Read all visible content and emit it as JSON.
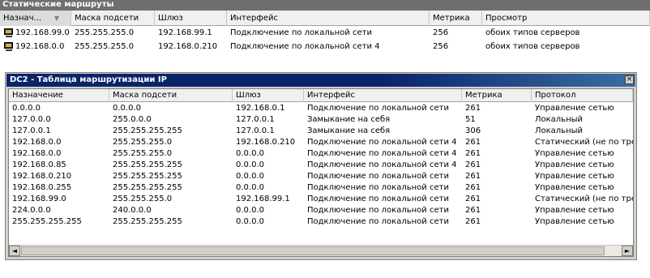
{
  "top": {
    "title": "Статические маршруты",
    "columns": [
      "Назнач...",
      "Маска подсети",
      "Шлюз",
      "Интерфейс",
      "Метрика",
      "Просмотр"
    ],
    "rows": [
      {
        "dest": "192.168.99.0",
        "mask": "255.255.255.0",
        "gateway": "192.168.99.1",
        "iface": "Подключение по локальной сети",
        "metric": "256",
        "view": "обоих типов серверов"
      },
      {
        "dest": "192.168.0.0",
        "mask": "255.255.255.0",
        "gateway": "192.168.0.210",
        "iface": "Подключение по локальной сети 4",
        "metric": "256",
        "view": "обоих типов серверов"
      }
    ]
  },
  "window": {
    "title": "DC2 - Таблица маршрутизации IP",
    "close_label": "×",
    "columns": [
      "Назначение",
      "Маска подсети",
      "Шлюз",
      "Интерфейс",
      "Метрика",
      "Протокол"
    ],
    "rows": [
      {
        "dest": "0.0.0.0",
        "mask": "0.0.0.0",
        "gateway": "192.168.0.1",
        "iface": "Подключение по локальной сети",
        "metric": "261",
        "protocol": "Управление сетью"
      },
      {
        "dest": "127.0.0.0",
        "mask": "255.0.0.0",
        "gateway": "127.0.0.1",
        "iface": "Замыкание на себя",
        "metric": "51",
        "protocol": "Локальный"
      },
      {
        "dest": "127.0.0.1",
        "mask": "255.255.255.255",
        "gateway": "127.0.0.1",
        "iface": "Замыкание на себя",
        "metric": "306",
        "protocol": "Локальный"
      },
      {
        "dest": "192.168.0.0",
        "mask": "255.255.255.0",
        "gateway": "192.168.0.210",
        "iface": "Подключение по локальной сети 4",
        "metric": "261",
        "protocol": "Статический (не по тре"
      },
      {
        "dest": "192.168.0.0",
        "mask": "255.255.255.0",
        "gateway": "0.0.0.0",
        "iface": "Подключение по локальной сети 4",
        "metric": "261",
        "protocol": "Управление сетью"
      },
      {
        "dest": "192.168.0.85",
        "mask": "255.255.255.255",
        "gateway": "0.0.0.0",
        "iface": "Подключение по локальной сети 4",
        "metric": "261",
        "protocol": "Управление сетью"
      },
      {
        "dest": "192.168.0.210",
        "mask": "255.255.255.255",
        "gateway": "0.0.0.0",
        "iface": "Подключение по локальной сети",
        "metric": "261",
        "protocol": "Управление сетью"
      },
      {
        "dest": "192.168.0.255",
        "mask": "255.255.255.255",
        "gateway": "0.0.0.0",
        "iface": "Подключение по локальной сети",
        "metric": "261",
        "protocol": "Управление сетью"
      },
      {
        "dest": "192.168.99.0",
        "mask": "255.255.255.0",
        "gateway": "192.168.99.1",
        "iface": "Подключение по локальной сети",
        "metric": "261",
        "protocol": "Статический (не по тре"
      },
      {
        "dest": "224.0.0.0",
        "mask": "240.0.0.0",
        "gateway": "0.0.0.0",
        "iface": "Подключение по локальной сети",
        "metric": "261",
        "protocol": "Управление сетью"
      },
      {
        "dest": "255.255.255.255",
        "mask": "255.255.255.255",
        "gateway": "0.0.0.0",
        "iface": "Подключение по локальной сети",
        "metric": "261",
        "protocol": "Управление сетью"
      }
    ],
    "scroll_left_icon": "scroll-left-arrow",
    "scroll_right_icon": "scroll-right-arrow"
  }
}
